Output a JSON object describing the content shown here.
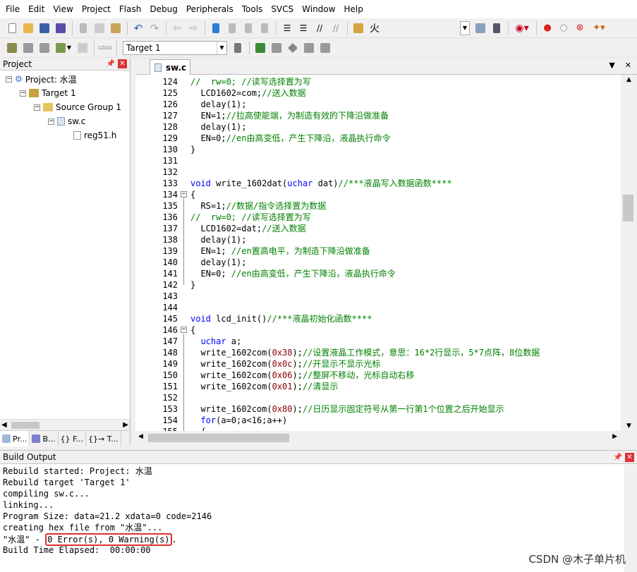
{
  "menu": [
    "File",
    "Edit",
    "View",
    "Project",
    "Flash",
    "Debug",
    "Peripherals",
    "Tools",
    "SVCS",
    "Window",
    "Help"
  ],
  "toolbar": {
    "find_text": "火",
    "target_name": "Target 1"
  },
  "project_panel": {
    "title": "Project",
    "tree": {
      "project": "Project: 水温",
      "target": "Target 1",
      "group": "Source Group 1",
      "file": "sw.c",
      "header": "reg51.h"
    },
    "tabs": [
      "Pr...",
      "B...",
      "{} F...",
      "{}→ T..."
    ]
  },
  "editor": {
    "tab_label": "sw.c",
    "lines": [
      {
        "n": "124",
        "t": "//  rw=0; //读写选择置为写",
        "cls": "cm"
      },
      {
        "n": "125",
        "t": "  LCD1602=com;//送入数据",
        "cls": ""
      },
      {
        "n": "126",
        "t": "  delay(1);",
        "cls": ""
      },
      {
        "n": "127",
        "t": "  EN=1;//拉高使能端，为制造有效的下降沿做准备",
        "cls": ""
      },
      {
        "n": "128",
        "t": "  delay(1);",
        "cls": ""
      },
      {
        "n": "129",
        "t": "  EN=0;//en由高变低，产生下降沿，液晶执行命令",
        "cls": ""
      },
      {
        "n": "130",
        "t": "}",
        "cls": ""
      },
      {
        "n": "131",
        "t": "",
        "cls": ""
      },
      {
        "n": "132",
        "t": "",
        "cls": ""
      },
      {
        "n": "133",
        "t": "void write_1602dat(uchar dat)//***液晶写入数据函数****",
        "cls": ""
      },
      {
        "n": "134",
        "t": "{",
        "cls": ""
      },
      {
        "n": "135",
        "t": "  RS=1;//数据/指令选择置为数据",
        "cls": ""
      },
      {
        "n": "136",
        "t": "//  rw=0; //读写选择置为写",
        "cls": "cm"
      },
      {
        "n": "137",
        "t": "  LCD1602=dat;//送入数据",
        "cls": ""
      },
      {
        "n": "138",
        "t": "  delay(1);",
        "cls": ""
      },
      {
        "n": "139",
        "t": "  EN=1; //en置高电平，为制造下降沿做准备",
        "cls": ""
      },
      {
        "n": "140",
        "t": "  delay(1);",
        "cls": ""
      },
      {
        "n": "141",
        "t": "  EN=0; //en由高变低，产生下降沿，液晶执行命令",
        "cls": ""
      },
      {
        "n": "142",
        "t": "}",
        "cls": ""
      },
      {
        "n": "143",
        "t": "",
        "cls": ""
      },
      {
        "n": "144",
        "t": "",
        "cls": ""
      },
      {
        "n": "145",
        "t": "void lcd_init()//***液晶初始化函数****",
        "cls": ""
      },
      {
        "n": "146",
        "t": "{",
        "cls": ""
      },
      {
        "n": "147",
        "t": "  uchar a;",
        "cls": ""
      },
      {
        "n": "148",
        "t": "  write_1602com(0x38);//设置液晶工作模式，意思：16*2行显示，5*7点阵，8位数据",
        "cls": ""
      },
      {
        "n": "149",
        "t": "  write_1602com(0x0c);//开显示不显示光标",
        "cls": ""
      },
      {
        "n": "150",
        "t": "  write_1602com(0x06);//整屏不移动，光标自动右移",
        "cls": ""
      },
      {
        "n": "151",
        "t": "  write_1602com(0x01);//清显示",
        "cls": ""
      },
      {
        "n": "152",
        "t": "",
        "cls": ""
      },
      {
        "n": "153",
        "t": "  write_1602com(0x80);//日历显示固定符号从第一行第1个位置之后开始显示",
        "cls": ""
      },
      {
        "n": "154",
        "t": "  for(a=0;a<16;a++)",
        "cls": ""
      },
      {
        "n": "155",
        "t": "  {",
        "cls": ""
      }
    ]
  },
  "build_output": {
    "title": "Build Output",
    "lines": [
      "Rebuild started: Project: 水温",
      "Rebuild target 'Target 1'",
      "compiling sw.c...",
      "linking...",
      "Program Size: data=21.2 xdata=0 code=2146",
      "creating hex file from \"水温\"..."
    ],
    "result_prefix": "\"水温\" - ",
    "result_highlight": "0 Error(s), 0 Warning(s)",
    "result_suffix": ".",
    "elapsed": "Build Time Elapsed:  00:00:00"
  },
  "watermark": "CSDN @木子单片机",
  "colors": {
    "comment": "#008000",
    "keyword": "#0000ff",
    "number": "#8b0000",
    "highlight_box": "#e0302f"
  }
}
